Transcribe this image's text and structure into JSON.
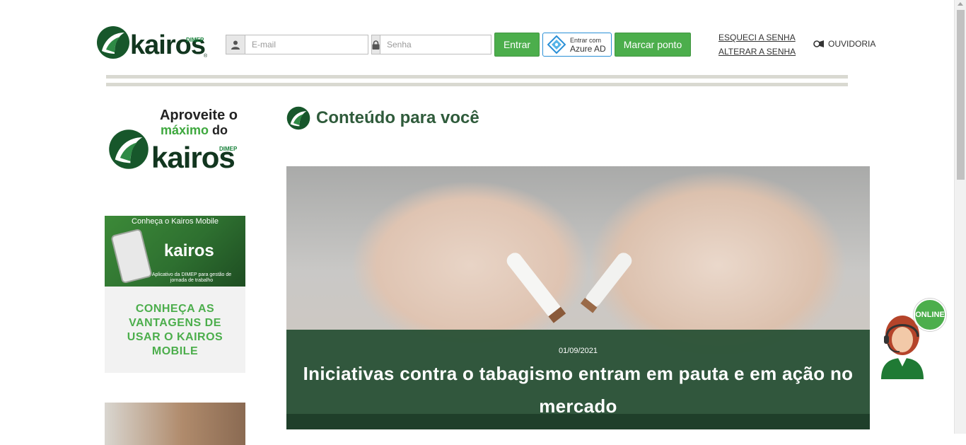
{
  "header": {
    "logo": {
      "word": "kairos",
      "brand": "DIMEP",
      "reg": "®"
    },
    "login": {
      "email_placeholder": "E-mail",
      "password_placeholder": "Senha"
    },
    "buttons": {
      "entrar": "Entrar",
      "azure_small": "Entrar com",
      "azure_big": "Azure AD",
      "marcar_ponto": "Marcar ponto"
    },
    "links": {
      "esqueci": "ESQUECI A SENHA",
      "alterar": "ALTERAR A SENHA",
      "ouvidoria": "OUVIDORIA"
    }
  },
  "sidebar": {
    "promo": {
      "line1": "Aproveite o",
      "line2_green": "máximo",
      "line2_dark": "do",
      "word": "kairos",
      "brand": "DIMEP"
    },
    "mobile_card": {
      "image_header": "Conheça o Kairos Mobile",
      "image_word": "kairos",
      "image_caption": "Aplicativo da DIMEP para gestão de jornada de trabalho",
      "title": "CONHEÇA AS VANTAGENS DE USAR O KAIROS MOBILE"
    }
  },
  "main": {
    "section_title": "Conteúdo para você",
    "featured": {
      "date": "01/09/2021",
      "headline": "Iniciativas contra o tabagismo entram em pauta e em ação no mercado"
    }
  },
  "chat": {
    "badge": "ONLINE"
  },
  "colors": {
    "accent_green": "#4cae4c",
    "dark_green": "#254f33",
    "logo_dark": "#12361f",
    "azure_blue": "#2a8fd6"
  }
}
